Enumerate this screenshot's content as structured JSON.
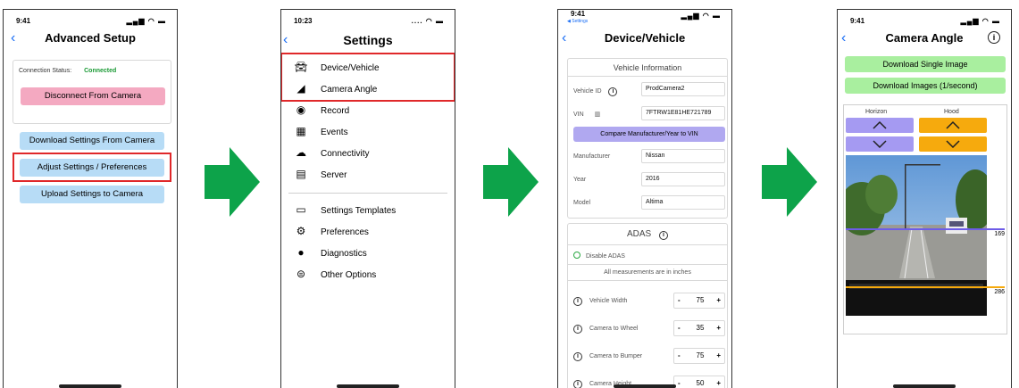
{
  "arrow_color": "#0da34a",
  "highlight_color": "#e0282a",
  "phone1": {
    "status": {
      "time": "9:41"
    },
    "title": "Advanced Setup",
    "connection_label": "Connection Status:",
    "connection_value": "Connected",
    "disconnect_label": "Disconnect From Camera",
    "download_label": "Download Settings From Camera",
    "adjust_label": "Adjust Settings / Preferences",
    "upload_label": "Upload Settings to Camera"
  },
  "phone2": {
    "status": {
      "time": "10:23"
    },
    "title": "Settings",
    "items": [
      {
        "label": "Device/Vehicle",
        "icon": "car-icon"
      },
      {
        "label": "Camera Angle",
        "icon": "camera-angle-icon"
      },
      {
        "label": "Record",
        "icon": "record-icon"
      },
      {
        "label": "Events",
        "icon": "calendar-icon"
      },
      {
        "label": "Connectivity",
        "icon": "cloud-icon"
      },
      {
        "label": "Server",
        "icon": "server-icon"
      },
      {
        "label": "Settings Templates",
        "icon": "laptop-icon"
      },
      {
        "label": "Preferences",
        "icon": "gear-icon"
      },
      {
        "label": "Diagnostics",
        "icon": "info-icon"
      },
      {
        "label": "Other Options",
        "icon": "options-icon"
      }
    ]
  },
  "phone3": {
    "status": {
      "time": "9:41",
      "back_app": "◀ Settings"
    },
    "title": "Device/Vehicle",
    "vehicle_info_title": "Vehicle Information",
    "vehicle_id_label": "Vehicle ID",
    "vehicle_id_value": "ProdCamera2",
    "vin_label": "VIN",
    "vin_value": "7FTRW1E81HE721789",
    "compare_label": "Compare Manufacturer/Year to VIN",
    "manufacturer_label": "Manufacturer",
    "manufacturer_value": "Nissan",
    "year_label": "Year",
    "year_value": "2016",
    "model_label": "Model",
    "model_value": "Altima",
    "adas_title": "ADAS",
    "disable_adas_label": "Disable ADAS",
    "measurements_note": "All measurements are in inches",
    "measurements": [
      {
        "label": "Vehicle Width",
        "value": "75"
      },
      {
        "label": "Camera to Wheel",
        "value": "35"
      },
      {
        "label": "Camera to Bumper",
        "value": "75"
      },
      {
        "label": "Camera Height",
        "value": "50"
      }
    ],
    "minus": "-",
    "plus": "+"
  },
  "phone4": {
    "status": {
      "time": "9:41"
    },
    "title": "Camera Angle",
    "download_single_label": "Download Single Image",
    "download_multi_label": "Download Images (1/second)",
    "horizon_label": "Horizon",
    "hood_label": "Hood",
    "horizon_value": "169",
    "hood_value": "286",
    "horizon_color": "#6e5ce8",
    "hood_color": "#f6aa0d"
  }
}
